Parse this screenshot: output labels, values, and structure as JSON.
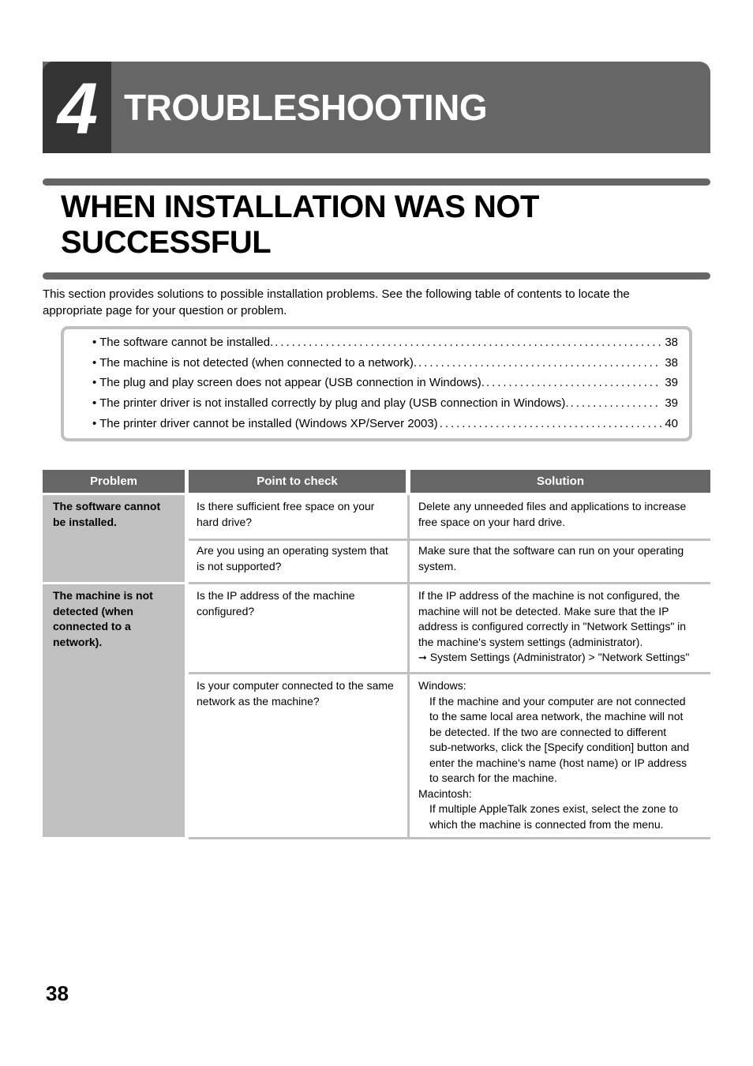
{
  "chapter": {
    "number": "4",
    "title": "TROUBLESHOOTING"
  },
  "section": {
    "title_line1": "WHEN INSTALLATION WAS NOT",
    "title_line2": "SUCCESSFUL"
  },
  "intro": {
    "line1": "This section provides solutions to possible installation problems. See the following table of contents to locate the",
    "line2": "appropriate page for your question or problem."
  },
  "toc": [
    {
      "label": "• The software cannot be installed.",
      "page": "38"
    },
    {
      "label": "• The machine is not detected (when connected to a network).",
      "page": "38"
    },
    {
      "label": "• The plug and play screen does not appear (USB connection in Windows).",
      "page": "39"
    },
    {
      "label": "• The printer driver is not installed correctly by plug and play (USB connection in Windows).",
      "page": "39"
    },
    {
      "label": "• The printer driver cannot be installed (Windows XP/Server 2003) ",
      "page": "40"
    }
  ],
  "table": {
    "headers": {
      "problem": "Problem",
      "check": "Point to check",
      "solution": "Solution"
    },
    "groups": [
      {
        "problem_lines": [
          "The software cannot",
          "be installed."
        ],
        "rows": [
          {
            "check_lines": [
              "Is there sufficient free space on your",
              "hard drive?"
            ],
            "solution_lines": [
              "Delete any unneeded files and applications to increase",
              "free space on your hard drive."
            ]
          },
          {
            "check_lines": [
              "Are you using an operating system that",
              "is not supported?"
            ],
            "solution_lines": [
              "Make sure that the software can run on your operating",
              "system."
            ]
          }
        ]
      },
      {
        "problem_lines": [
          "The machine is not",
          "detected (when",
          "connected to a",
          "network)."
        ],
        "rows": [
          {
            "check_lines": [
              "Is the IP address of the machine",
              "configured?"
            ],
            "solution_lines": [
              "If the IP address of the machine is not configured, the",
              "machine will not be detected. Make sure that the IP",
              "address is configured correctly in \"Network Settings\" in",
              "the machine's system settings (administrator)."
            ],
            "solution_ref_arrow": "➞",
            "solution_ref": "System Settings (Administrator) > \"Network Settings\""
          },
          {
            "check_lines": [
              "Is your computer connected to the same",
              "network as the machine?"
            ],
            "solution_windows_heading": "Windows:",
            "solution_windows_lines": [
              "If the machine and your computer are not connected",
              "to the same local area network, the machine will not",
              "be detected. If the two are connected to different",
              "sub-networks, click the [Specify condition] button and",
              "enter the machine's name (host name) or IP address",
              "to search for the machine."
            ],
            "solution_mac_heading": "Macintosh:",
            "solution_mac_lines": [
              "If multiple AppleTalk zones exist, select the zone to",
              "which the machine is connected from the menu."
            ]
          }
        ]
      }
    ]
  },
  "page_number": "38",
  "colors": {
    "banner_dark": "#333333",
    "banner": "#666666",
    "problem_fill": "#c0c0c0",
    "rule": "#c0c0c0"
  }
}
